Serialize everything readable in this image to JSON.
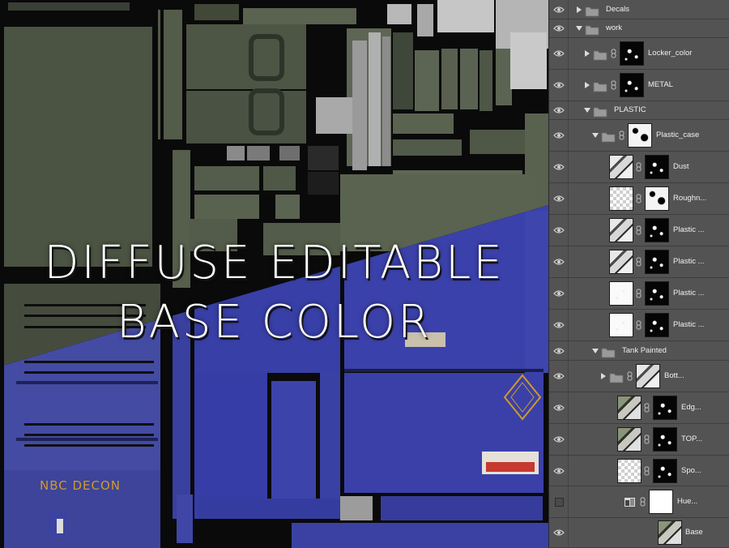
{
  "canvas": {
    "overlay_title_line1": "DIFFUSE EDITABLE",
    "overlay_title_line2": "BASE COLOR",
    "decal_text": "NBC DECON"
  },
  "colors": {
    "olive_texture": "#4c5444",
    "blue_texture": "#3a3fa8",
    "dark_gaps": "#0a0a0a",
    "panel_bg": "#535353",
    "decal_orange": "#d09a2a"
  },
  "layers": [
    {
      "name": "Decals",
      "kind": "folder",
      "visible": true,
      "expand": "collapsed"
    },
    {
      "name": "work",
      "kind": "folder",
      "visible": true,
      "expand": "expanded"
    },
    {
      "name": "Locker_color",
      "kind": "folder-mask",
      "visible": true,
      "expand": "collapsed"
    },
    {
      "name": "METAL",
      "kind": "folder-mask",
      "visible": true,
      "expand": "collapsed"
    },
    {
      "name": "PLASTIC",
      "kind": "folder",
      "visible": true,
      "expand": "expanded"
    },
    {
      "name": "Plastic_case",
      "kind": "folder-mask",
      "visible": true,
      "expand": "expanded"
    },
    {
      "name": "Dust",
      "kind": "layer-mask",
      "visible": true
    },
    {
      "name": "Roughn...",
      "kind": "layer-mask",
      "visible": true
    },
    {
      "name": "Plastic ...",
      "kind": "layer-mask",
      "visible": true
    },
    {
      "name": "Plastic ...",
      "kind": "layer-mask",
      "visible": true
    },
    {
      "name": "Plastic ...",
      "kind": "layer-mask",
      "visible": true
    },
    {
      "name": "Plastic ...",
      "kind": "layer-mask",
      "visible": true
    },
    {
      "name": "Tank Painted",
      "kind": "folder",
      "visible": true,
      "expand": "expanded"
    },
    {
      "name": "Bott...",
      "kind": "folder-thumb",
      "visible": true,
      "expand": "collapsed"
    },
    {
      "name": "Edg...",
      "kind": "layer-mask",
      "visible": true
    },
    {
      "name": "TOP...",
      "kind": "layer-mask",
      "visible": true
    },
    {
      "name": "Spo...",
      "kind": "layer-mask",
      "visible": true
    },
    {
      "name": "Hue...",
      "kind": "adjustment",
      "visible": false
    },
    {
      "name": "Base",
      "kind": "layer",
      "visible": true
    }
  ]
}
